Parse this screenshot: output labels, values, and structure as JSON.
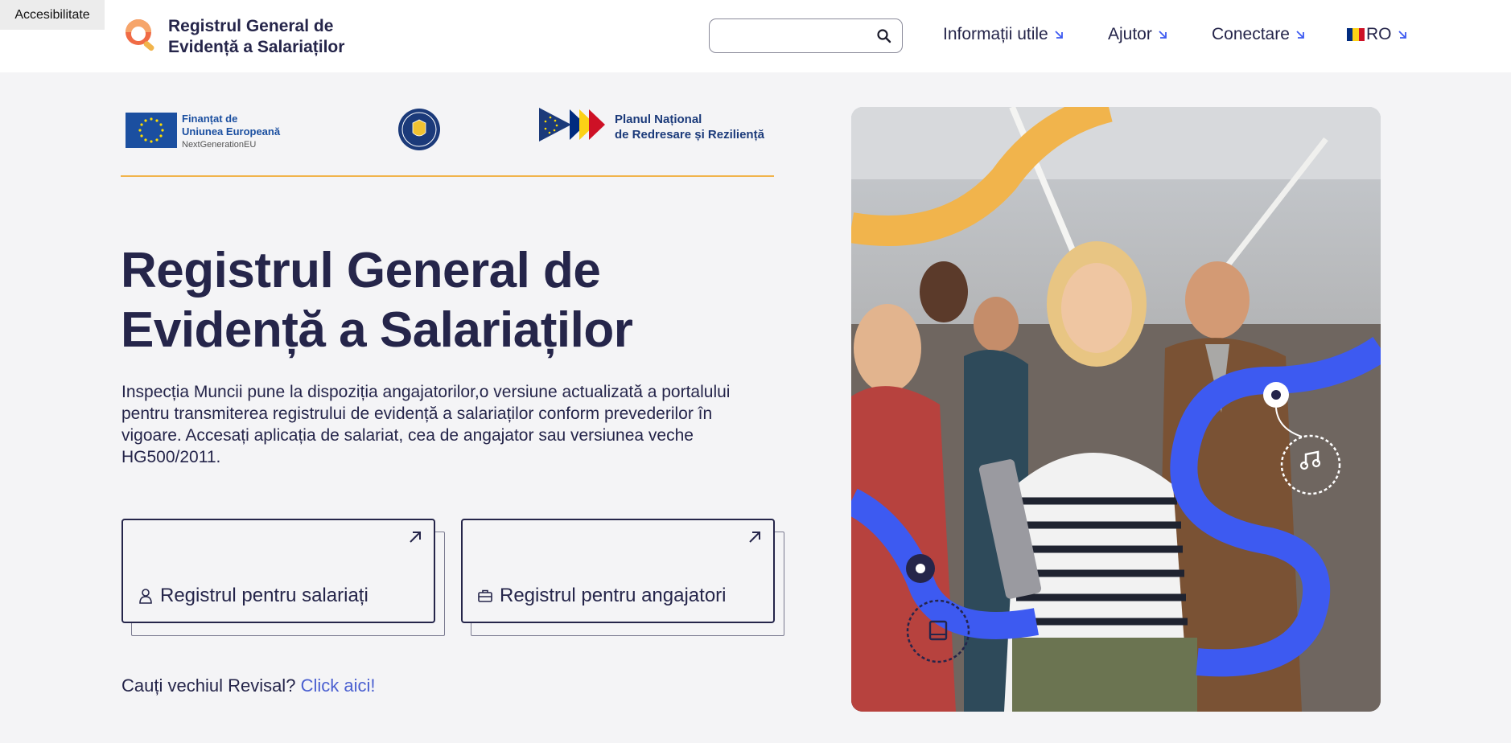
{
  "accessibility_label": "Accesibilitate",
  "header": {
    "title_line1": "Registrul General de",
    "title_line2": "Evidență a Salariaților",
    "search": {
      "value": "",
      "placeholder": ""
    },
    "nav": [
      {
        "label": "Informații utile"
      },
      {
        "label": "Ajutor"
      },
      {
        "label": "Conectare"
      },
      {
        "label": "RO"
      }
    ]
  },
  "funding": {
    "eu_line1": "Finanțat de",
    "eu_line2": "Uniunea Europeană",
    "eu_line3": "NextGenerationEU",
    "pnrr_line1": "Planul Național",
    "pnrr_line2": "de Redresare și Reziliență"
  },
  "main": {
    "title_line1": "Registrul General de",
    "title_line2": "Evidență a Salariaților",
    "intro": "Inspecția Muncii pune la dispoziția angajatorilor,o versiune actualizată a portalului pentru transmiterea registrului de evidență a salariaților conform prevederilor în vigoare. Accesați aplicația de salariat, cea de angajator sau versiunea veche HG500/2011.",
    "cards": [
      {
        "label": "Registrul pentru salariați",
        "icon": "user-icon"
      },
      {
        "label": "Registrul pentru angajatori",
        "icon": "briefcase-icon"
      }
    ],
    "old_prompt": "Cauți vechiul Revisal?",
    "old_link": "Click aici!"
  },
  "colors": {
    "primary_text": "#25254a",
    "accent_blue": "#3d5af1",
    "accent_orange": "#f1b44c",
    "link": "#4a5fd0",
    "background": "#f4f4f6"
  }
}
